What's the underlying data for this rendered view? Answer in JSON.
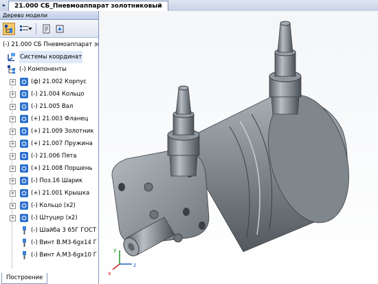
{
  "document": {
    "tab_title": "21.000 СБ_Пневмоаппарат золотниковый"
  },
  "panel": {
    "title": "Дерево модели",
    "root_label": "(-) 21.000 СБ Пневмоаппарат золо",
    "coordinate_systems": "Системы координат",
    "components_group": "(-) Компоненты",
    "items": [
      "(ф) 21.002 Корпус",
      "(-) 21.004 Кольцо",
      "(-) 21.005 Вал",
      "(+) 21.003 Фланец",
      "(+) 21.009 Золотник",
      "(+) 21.007 Пружина",
      "(-) 21.006 Пята",
      "(+) 21.008 Поршень",
      "(-) Поз.16 Шарик",
      "(+) 21.001 Крышка",
      "(-) Кольцо (x2)",
      "(-) Штуцер (x2)",
      "(-) Шайба 3 65Г ГОСТ",
      "(-) Винт В.М3-6gx14 Г",
      "(-) Винт А.М3-6gx10 Г"
    ],
    "bottom_tab": "Построение"
  },
  "axes": {
    "x": "x",
    "y": "y",
    "z": "z"
  },
  "colors": {
    "part_fill": "#8f969c",
    "part_dark": "#4d5358",
    "accent_blue": "#1e63c4"
  }
}
